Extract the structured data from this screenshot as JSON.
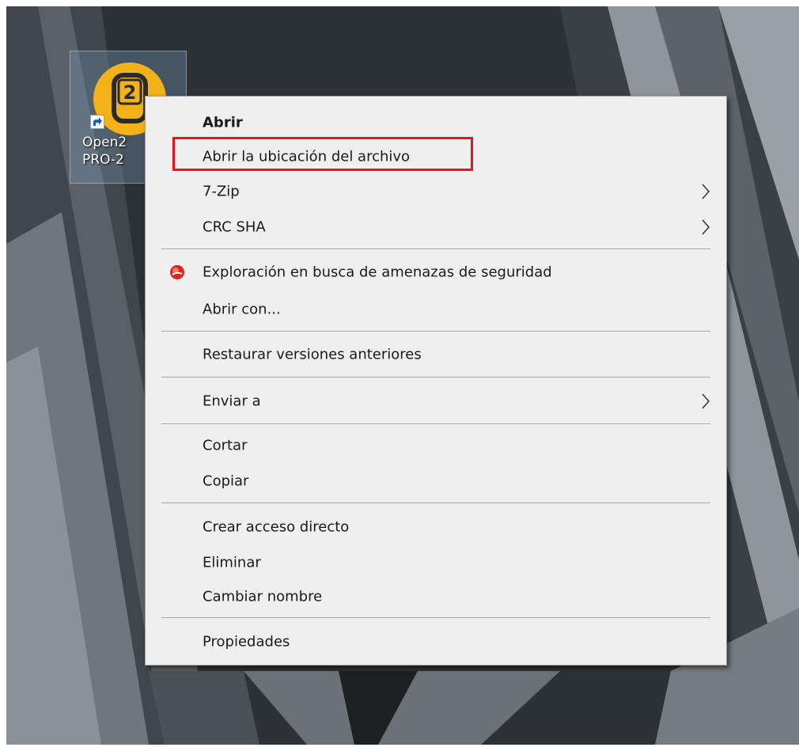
{
  "desktop_icon": {
    "badge_number": "2",
    "label_line1": "Open2",
    "label_line2": "PRO-2"
  },
  "context_menu": {
    "items": [
      {
        "label": "Abrir",
        "bold": true
      },
      {
        "label": "Abrir la ubicación del archivo",
        "highlighted": true
      },
      {
        "label": "7-Zip",
        "submenu": true
      },
      {
        "label": "CRC SHA",
        "submenu": true
      },
      {
        "label": "Exploración en busca de amenazas de seguridad",
        "icon": "security-scan-icon"
      },
      {
        "label": "Abrir con..."
      },
      {
        "label": "Restaurar versiones anteriores"
      },
      {
        "label": "Enviar a",
        "submenu": true
      },
      {
        "label": "Cortar"
      },
      {
        "label": "Copiar"
      },
      {
        "label": "Crear acceso directo"
      },
      {
        "label": "Eliminar"
      },
      {
        "label": "Cambiar nombre"
      },
      {
        "label": "Propiedades"
      }
    ]
  },
  "colors": {
    "highlight_box": "#e8141b",
    "menu_background": "#efefef",
    "icon_yellow": "#f2b31a"
  }
}
